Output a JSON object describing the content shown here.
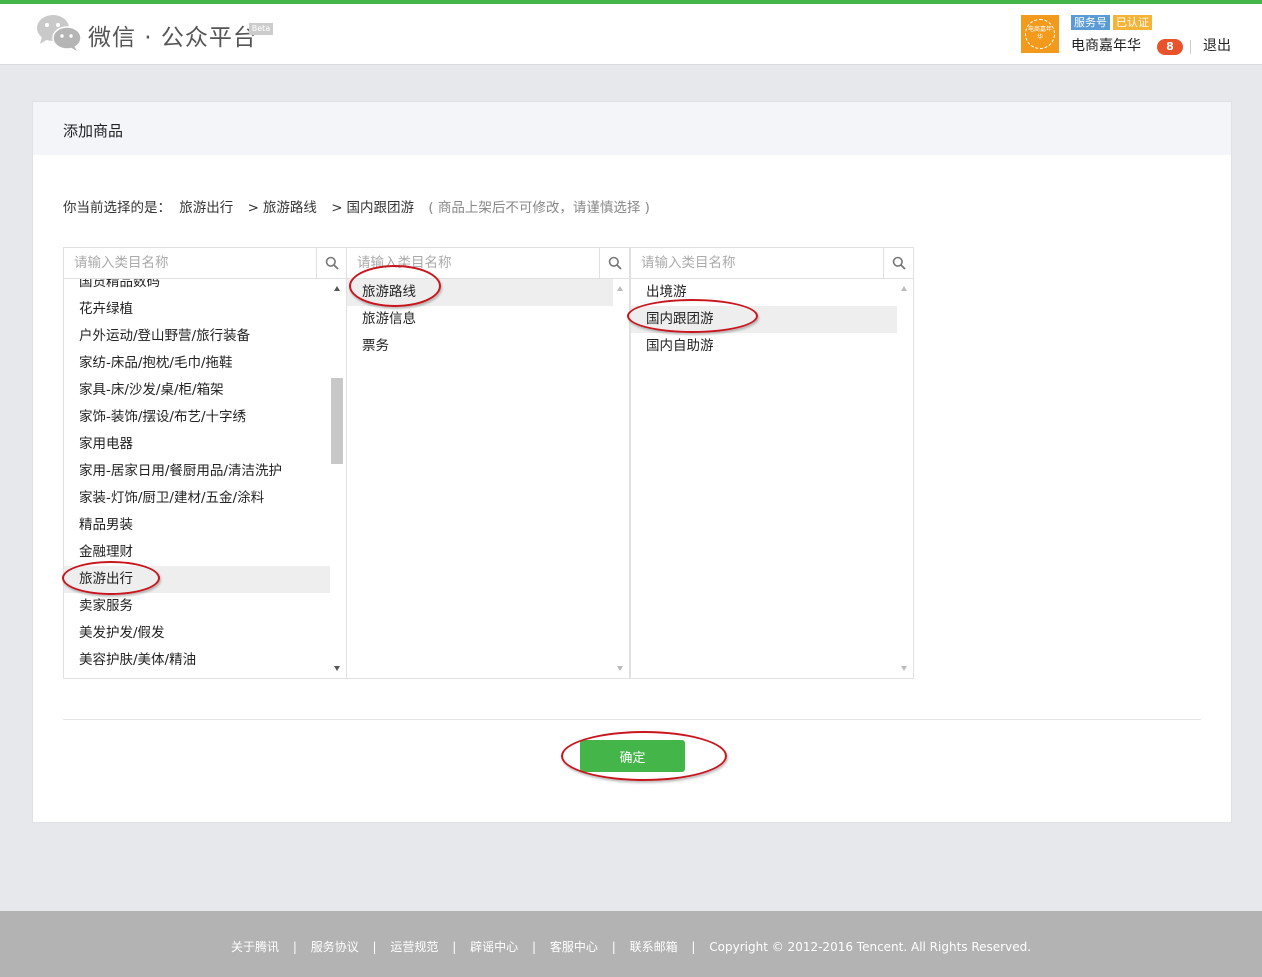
{
  "header": {
    "logo_text": "微信 · 公众平台",
    "beta": "Beta",
    "avatar_text": "电商嘉年华",
    "badge_service": "服务号",
    "badge_verified": "已认证",
    "account_name": "电商嘉年华",
    "notice_count": "8",
    "logout": "退出"
  },
  "panel": {
    "title": "添加商品",
    "selection_label": "你当前选择的是：",
    "selection_path": [
      "旅游出行",
      "旅游路线",
      "国内跟团游"
    ],
    "selection_separator": ">",
    "selection_note": "( 商品上架后不可修改，请谨慎选择 )",
    "confirm": "确定"
  },
  "columns": [
    {
      "placeholder": "请输入类目名称",
      "items": [
        "国货精品数码",
        "花卉绿植",
        "户外运动/登山野营/旅行装备",
        "家纺-床品/抱枕/毛巾/拖鞋",
        "家具-床/沙发/桌/柜/箱架",
        "家饰-装饰/摆设/布艺/十字绣",
        "家用电器",
        "家用-居家日用/餐厨用品/清洁洗护",
        "家装-灯饰/厨卫/建材/五金/涂料",
        "精品男装",
        "金融理财",
        "旅游出行",
        "卖家服务",
        "美发护发/假发",
        "美容护肤/美体/精油"
      ],
      "selected": "旅游出行"
    },
    {
      "placeholder": "请输入类目名称",
      "items": [
        "旅游路线",
        "旅游信息",
        "票务"
      ],
      "selected": "旅游路线"
    },
    {
      "placeholder": "请输入类目名称",
      "items": [
        "出境游",
        "国内跟团游",
        "国内自助游"
      ],
      "selected": "国内跟团游"
    }
  ],
  "footer": {
    "links": [
      "关于腾讯",
      "服务协议",
      "运营规范",
      "辟谣中心",
      "客服中心",
      "联系邮箱"
    ],
    "separator": "|",
    "copyright": "Copyright © 2012-2016 Tencent. All Rights Reserved."
  },
  "colors": {
    "brand_green": "#44b549",
    "annotation_red": "#c8161d",
    "badge_blue": "#5a9bd5",
    "badge_orange": "#f5b338",
    "notice_red": "#e9532c"
  }
}
